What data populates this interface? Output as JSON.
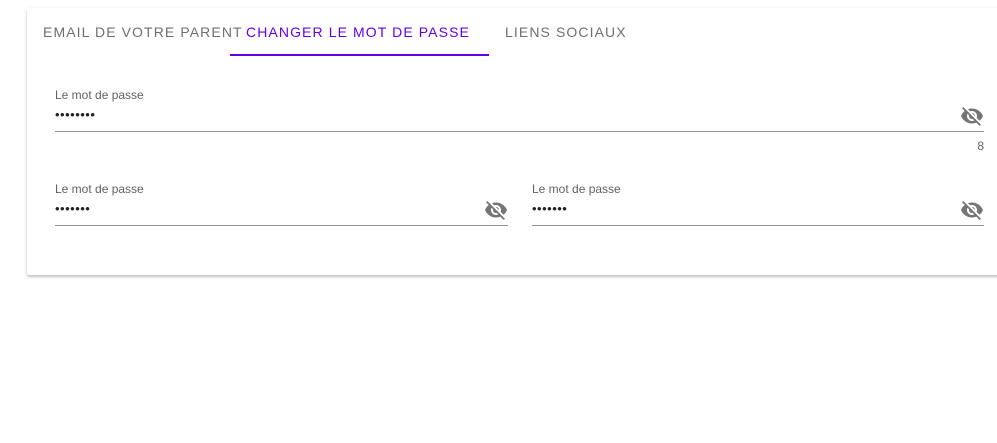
{
  "tabs": [
    {
      "label": "EMAIL DE VOTRE PARENT",
      "active": false
    },
    {
      "label": "CHANGER LE MOT DE PASSE",
      "active": true
    },
    {
      "label": "LIENS SOCIAUX",
      "active": false
    }
  ],
  "colors": {
    "accent": "#6200ea",
    "tab_inactive": "#6f6f6f",
    "underline": "#949494",
    "icon": "#757575"
  },
  "fields": {
    "current_password": {
      "label": "Le mot de passe",
      "value": "••••••••",
      "counter": "8",
      "icon": "eye-off-icon"
    },
    "new_password": {
      "label": "Le mot de passe",
      "value": "•••••••",
      "icon": "eye-off-icon"
    },
    "confirm_password": {
      "label": "Le mot de passe",
      "value": "•••••••",
      "icon": "eye-off-icon"
    }
  }
}
